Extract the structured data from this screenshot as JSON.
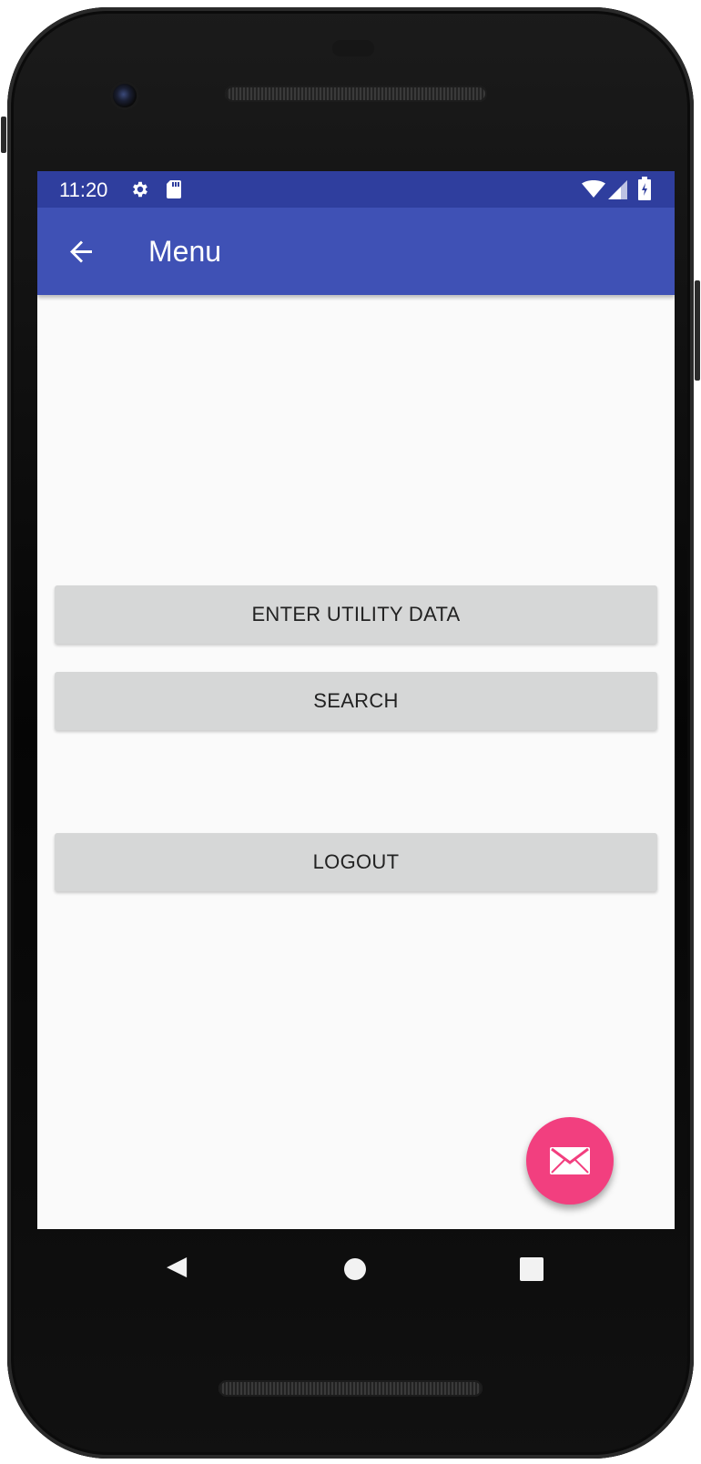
{
  "status_bar": {
    "time": "11:20",
    "icons": [
      "gear-icon",
      "sd-card-icon",
      "wifi-icon",
      "signal-icon",
      "battery-icon"
    ]
  },
  "app_bar": {
    "title": "Menu",
    "back_icon": "arrow-back-icon"
  },
  "buttons": {
    "enter_utility_data": "ENTER UTILITY DATA",
    "search": "SEARCH",
    "logout": "LOGOUT"
  },
  "fab": {
    "icon": "email-icon"
  },
  "navigation": {
    "back": "nav-back-icon",
    "home": "nav-home-icon",
    "recents": "nav-recents-icon"
  },
  "colors": {
    "status_bar": "#2f3e9e",
    "app_bar": "#3f51b5",
    "fab": "#f23f7f",
    "button": "#d6d7d7",
    "background": "#fafafa"
  }
}
